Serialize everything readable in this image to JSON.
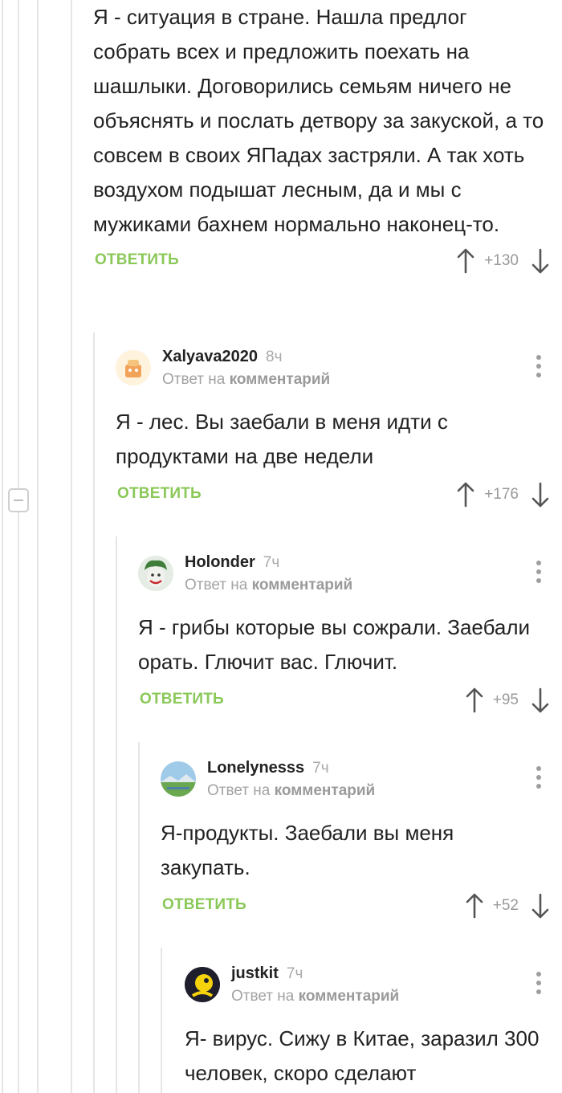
{
  "comments": [
    {
      "text": "Я - ситуация в стране. Нашла предлог собрать всех и предложить поехать на шашлыки. Договорились семьям ничего не объяснять и послать детвору за закуской, а то совсем в своих ЯПадах застряли. А так хоть воздухом подышат лесным, да и мы с мужиками бахнем нормально наконец-то.",
      "reply_label": "ОТВЕТИТЬ",
      "rating": "+130"
    },
    {
      "author": "Xalyava2020",
      "time": "8ч",
      "reply_prefix": "Ответ на",
      "reply_target": "комментарий",
      "text": "Я - лес. Вы заебали в меня идти с продуктами на две недели",
      "reply_label": "ОТВЕТИТЬ",
      "rating": "+176"
    },
    {
      "author": "Holonder",
      "time": "7ч",
      "reply_prefix": "Ответ на",
      "reply_target": "комментарий",
      "text": "Я - грибы которые вы сожрали. Заебали орать. Глючит вас. Глючит.",
      "reply_label": "ОТВЕТИТЬ",
      "rating": "+95"
    },
    {
      "author": "Lonelynesss",
      "time": "7ч",
      "reply_prefix": "Ответ на",
      "reply_target": "комментарий",
      "text": "Я-продукты. Заебали вы меня закупать.",
      "reply_label": "ОТВЕТИТЬ",
      "rating": "+52"
    },
    {
      "author": "justkit",
      "time": "7ч",
      "reply_prefix": "Ответ на",
      "reply_target": "комментарий",
      "text": "Я- вирус. Сижу в Китае, заразил 300 человек, скоро сделают"
    }
  ],
  "colors": {
    "accent_green": "#8ac858",
    "muted_gray": "#a3a3a3",
    "thread_line": "#e6e6e6"
  },
  "icons": [
    "more-vertical-icon",
    "upvote-arrow-icon",
    "downvote-arrow-icon",
    "collapse-minus-icon"
  ]
}
